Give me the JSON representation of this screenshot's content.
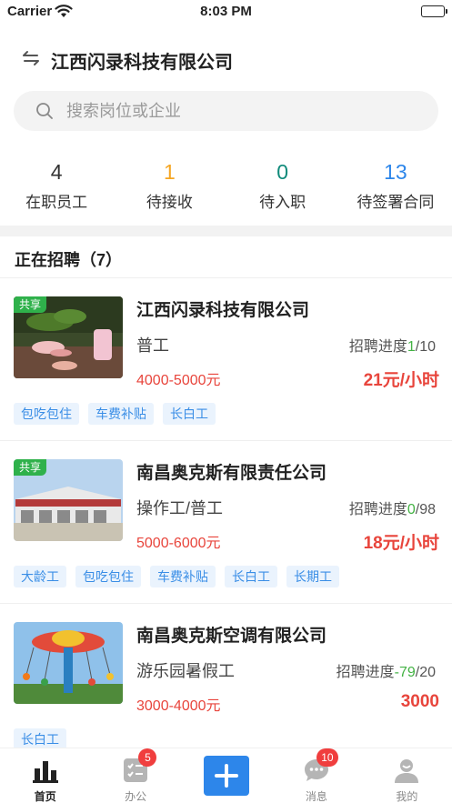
{
  "status_bar": {
    "carrier": "Carrier",
    "time": "8:03 PM"
  },
  "header": {
    "company": "江西闪录科技有限公司"
  },
  "search": {
    "placeholder": "搜索岗位或企业"
  },
  "stats": [
    {
      "value": "4",
      "label": "在职员工",
      "color": "#333333"
    },
    {
      "value": "1",
      "label": "待接收",
      "color": "#f5a623"
    },
    {
      "value": "0",
      "label": "待入职",
      "color": "#0f8a7a"
    },
    {
      "value": "13",
      "label": "待签署合同",
      "color": "#2d86ea"
    }
  ],
  "section": {
    "title": "正在招聘（7）"
  },
  "jobs": [
    {
      "badge": "共享",
      "company": "江西闪录科技有限公司",
      "title": "普工",
      "progress_label": "招聘进度",
      "progress_current": "1",
      "progress_total": "/10",
      "salary": "4000-5000元",
      "rate": "21元/小时",
      "tags": [
        "包吃包住",
        "车费补贴",
        "长白工"
      ]
    },
    {
      "badge": "共享",
      "company": "南昌奥克斯有限责任公司",
      "title": "操作工/普工",
      "progress_label": "招聘进度",
      "progress_current": "0",
      "progress_total": "/98",
      "salary": "5000-6000元",
      "rate": "18元/小时",
      "tags": [
        "大龄工",
        "包吃包住",
        "车费补贴",
        "长白工",
        "长期工"
      ]
    },
    {
      "company": "南昌奥克斯空调有限公司",
      "title": "游乐园暑假工",
      "progress_label": "招聘进度",
      "progress_current": "-79",
      "progress_total": "/20",
      "salary": "3000-4000元",
      "rate": "3000",
      "tags": [
        "长白工"
      ]
    }
  ],
  "tabbar": {
    "items": [
      {
        "label": "首页",
        "icon": "bar-chart-icon",
        "active": true
      },
      {
        "label": "办公",
        "icon": "checklist-icon",
        "badge": "5"
      },
      {
        "label": "",
        "icon": "plus-icon"
      },
      {
        "label": "消息",
        "icon": "chat-icon",
        "badge": "10"
      },
      {
        "label": "我的",
        "icon": "user-icon"
      }
    ]
  }
}
